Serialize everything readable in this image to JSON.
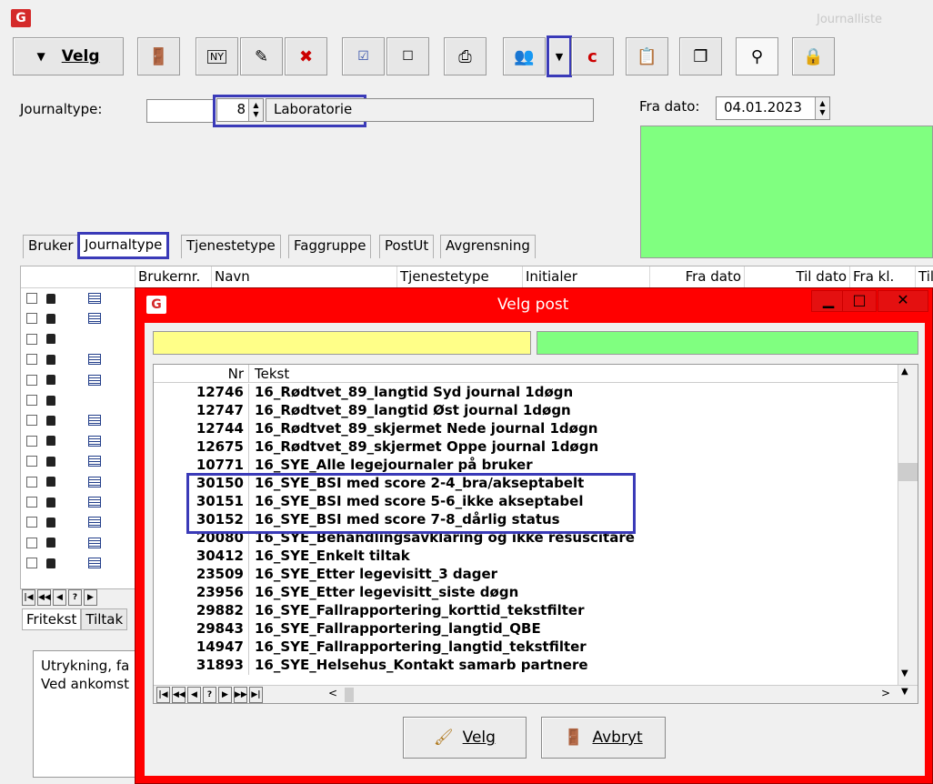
{
  "window": {
    "logo": "G",
    "title": "Journalliste"
  },
  "toolbar": {
    "velg_label": "Velg",
    "icons": [
      "door-exit-icon",
      "new-icon",
      "edit-icon",
      "delete-icon",
      "check-list-icon",
      "list-icon",
      "print-icon",
      "people-icon",
      "dropdown-arrow-icon",
      "c-icon",
      "paste-icon",
      "copy-icon",
      "search-users-icon",
      "lock-icon"
    ],
    "c_label": "c"
  },
  "form": {
    "journaltype_label": "Journaltype:",
    "journaltype_value": "8",
    "journaltype_text": "Laboratorie",
    "fra_dato_label": "Fra dato:",
    "fra_dato_value": "04.01.2023"
  },
  "tabs": [
    "Bruker",
    "Journaltype",
    "Tjenestetype",
    "Faggruppe",
    "PostUt",
    "Avgrensning"
  ],
  "grid": {
    "columns": [
      "Brukernr.",
      "Navn",
      "Tjenestetype",
      "Initialer",
      "Fra dato",
      "Til dato",
      "Fra kl.",
      "Til"
    ]
  },
  "bottom_tabs": [
    "Fritekst",
    "Tiltak"
  ],
  "fritekst": {
    "line1": "Utrykning, fa",
    "line2": "Ved ankomst"
  },
  "nav_buttons": [
    "|◀",
    "◀◀",
    "◀",
    "?",
    "▶",
    "▶▶",
    "▶|"
  ],
  "dialog": {
    "title": "Velg post",
    "minimize": "▁",
    "maximize": "□",
    "close": "✕",
    "list_header": {
      "nr": "Nr",
      "tekst": "Tekst"
    },
    "rows": [
      {
        "nr": "12746",
        "tekst": "16_Rødtvet_89_langtid Syd  journal 1døgn"
      },
      {
        "nr": "12747",
        "tekst": "16_Rødtvet_89_langtid Øst  journal 1døgn"
      },
      {
        "nr": "12744",
        "tekst": "16_Rødtvet_89_skjermet Nede  journal 1døgn"
      },
      {
        "nr": "12675",
        "tekst": "16_Rødtvet_89_skjermet Oppe  journal 1døgn"
      },
      {
        "nr": "10771",
        "tekst": "16_SYE_Alle legejournaler på bruker"
      },
      {
        "nr": "30150",
        "tekst": "16_SYE_BSI med score 2-4_bra/akseptabelt"
      },
      {
        "nr": "30151",
        "tekst": "16_SYE_BSI med score 5-6_ikke akseptabel"
      },
      {
        "nr": "30152",
        "tekst": "16_SYE_BSI med score 7-8_dårlig status"
      },
      {
        "nr": "20080",
        "tekst": "16_SYE_Behandlingsavklaring og ikke resuscitare"
      },
      {
        "nr": "30412",
        "tekst": "16_SYE_Enkelt tiltak"
      },
      {
        "nr": "23509",
        "tekst": "16_SYE_Etter legevisitt_3 dager"
      },
      {
        "nr": "23956",
        "tekst": "16_SYE_Etter legevisitt_siste døgn"
      },
      {
        "nr": "29882",
        "tekst": "16_SYE_Fallrapportering_korttid_tekstfilter"
      },
      {
        "nr": "29843",
        "tekst": "16_SYE_Fallrapportering_langtid_QBE"
      },
      {
        "nr": "14947",
        "tekst": "16_SYE_Fallrapportering_langtid_tekstfilter"
      },
      {
        "nr": "31893",
        "tekst": "16_SYE_Helsehus_Kontakt samarb partnere"
      }
    ],
    "velg_label": "Velg",
    "avbryt_label": "Avbryt"
  }
}
